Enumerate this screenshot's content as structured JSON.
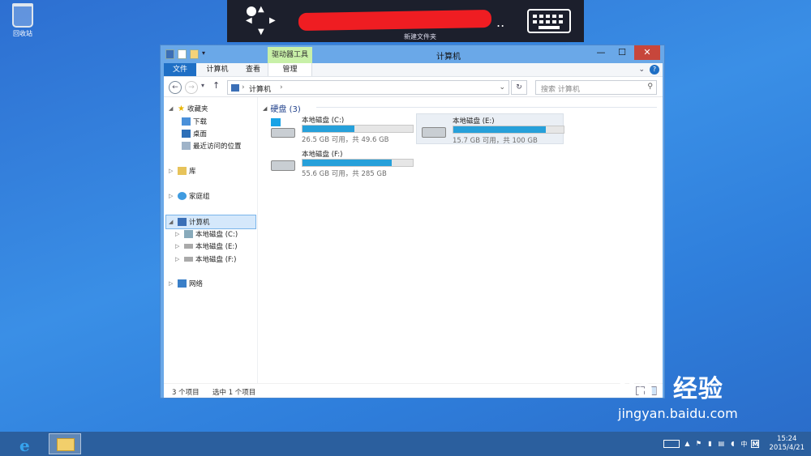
{
  "desktop": {
    "recycle_bin_label": "回收站"
  },
  "remote_bar": {
    "title_redacted": "",
    "subtitle": "新建文件夹",
    "trailing": ".."
  },
  "window": {
    "title": "计算机",
    "contextual_tab": "驱动器工具",
    "ribbon_tabs": [
      "文件",
      "计算机",
      "查看",
      "管理"
    ],
    "address_path": "计算机",
    "search_placeholder": "搜索 计算机",
    "sidebar": {
      "favorites": "收藏夹",
      "downloads": "下载",
      "desktop": "桌面",
      "recent": "最近访问的位置",
      "libraries": "库",
      "homegroup": "家庭组",
      "computer": "计算机",
      "drive_c": "本地磁盘 (C:)",
      "drive_e": "本地磁盘 (E:)",
      "drive_f": "本地磁盘 (F:)",
      "network": "网络"
    },
    "group_header": "硬盘 (3)",
    "drives": [
      {
        "name": "本地磁盘 (C:)",
        "free_text": "26.5 GB 可用，共 49.6 GB",
        "used_fraction": 0.47
      },
      {
        "name": "本地磁盘 (E:)",
        "free_text": "15.7 GB 可用，共 100 GB",
        "used_fraction": 0.84
      },
      {
        "name": "本地磁盘 (F:)",
        "free_text": "55.6 GB 可用，共 285 GB",
        "used_fraction": 0.81
      }
    ],
    "status_items": "3 个项目",
    "status_selected": "选中 1 个项目"
  },
  "taskbar": {
    "tray_ime": "中",
    "tray_m": "M",
    "time": "15:24",
    "date": "2015/4/21"
  },
  "watermark": {
    "brand": "Bai 经验",
    "url": "jingyan.baidu.com"
  },
  "colors": {
    "accent": "#1f6fc5",
    "bar_fill": "#26a0da",
    "close": "#c7463b",
    "contextual": "#c8f0a8"
  }
}
